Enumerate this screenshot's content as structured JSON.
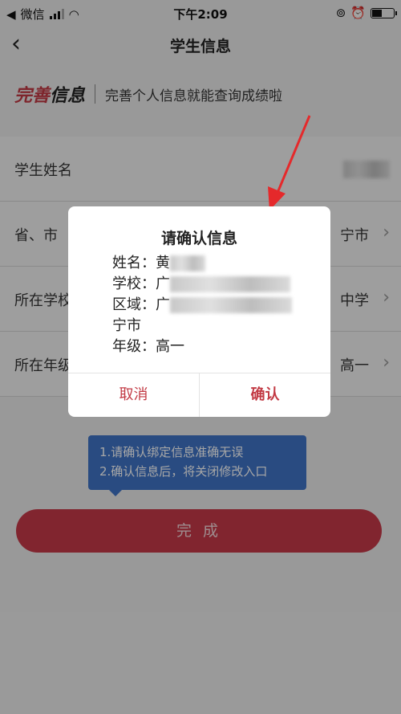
{
  "status_bar": {
    "carrier": "微信",
    "time": "下午2:09",
    "battery_level": 0.5
  },
  "nav": {
    "title": "学生信息"
  },
  "banner": {
    "brand_a": "完善",
    "brand_b": "信息",
    "subtitle": "完善个人信息就能查询成绩啦"
  },
  "form": {
    "rows": [
      {
        "label": "学生姓名",
        "value": ""
      },
      {
        "label": "省、市",
        "value": "宁市"
      },
      {
        "label": "所在学校",
        "value": "中学"
      },
      {
        "label": "所在年级",
        "value": "高一"
      }
    ]
  },
  "tooltip": {
    "line1": "1.请确认绑定信息准确无误",
    "line2": "2.确认信息后，将关闭修改入口"
  },
  "complete_button": "完 成",
  "dialog": {
    "title": "请确认信息",
    "name_label": "姓名：",
    "name_value": "黄",
    "school_label": "学校：",
    "school_value": "广",
    "region_label": "区域：",
    "region_value": "广",
    "region_cont": "宁市",
    "grade_label": "年级：",
    "grade_value": "高一",
    "cancel": "取消",
    "confirm": "确认"
  },
  "colors": {
    "accent": "#c23a44",
    "tooltip_bg": "#3f74c6",
    "button_bg": "#c63a49",
    "arrow": "#e5292b"
  }
}
